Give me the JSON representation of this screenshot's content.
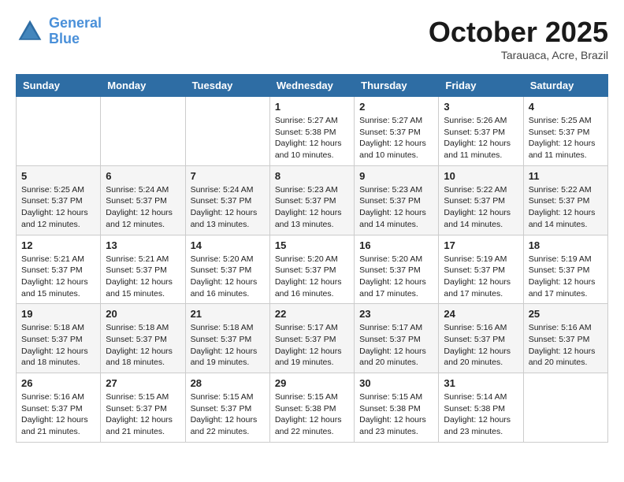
{
  "header": {
    "logo_line1": "General",
    "logo_line2": "Blue",
    "month": "October 2025",
    "location": "Tarauaca, Acre, Brazil"
  },
  "weekdays": [
    "Sunday",
    "Monday",
    "Tuesday",
    "Wednesday",
    "Thursday",
    "Friday",
    "Saturday"
  ],
  "weeks": [
    [
      {
        "day": "",
        "info": ""
      },
      {
        "day": "",
        "info": ""
      },
      {
        "day": "",
        "info": ""
      },
      {
        "day": "1",
        "info": "Sunrise: 5:27 AM\nSunset: 5:38 PM\nDaylight: 12 hours\nand 10 minutes."
      },
      {
        "day": "2",
        "info": "Sunrise: 5:27 AM\nSunset: 5:37 PM\nDaylight: 12 hours\nand 10 minutes."
      },
      {
        "day": "3",
        "info": "Sunrise: 5:26 AM\nSunset: 5:37 PM\nDaylight: 12 hours\nand 11 minutes."
      },
      {
        "day": "4",
        "info": "Sunrise: 5:25 AM\nSunset: 5:37 PM\nDaylight: 12 hours\nand 11 minutes."
      }
    ],
    [
      {
        "day": "5",
        "info": "Sunrise: 5:25 AM\nSunset: 5:37 PM\nDaylight: 12 hours\nand 12 minutes."
      },
      {
        "day": "6",
        "info": "Sunrise: 5:24 AM\nSunset: 5:37 PM\nDaylight: 12 hours\nand 12 minutes."
      },
      {
        "day": "7",
        "info": "Sunrise: 5:24 AM\nSunset: 5:37 PM\nDaylight: 12 hours\nand 13 minutes."
      },
      {
        "day": "8",
        "info": "Sunrise: 5:23 AM\nSunset: 5:37 PM\nDaylight: 12 hours\nand 13 minutes."
      },
      {
        "day": "9",
        "info": "Sunrise: 5:23 AM\nSunset: 5:37 PM\nDaylight: 12 hours\nand 14 minutes."
      },
      {
        "day": "10",
        "info": "Sunrise: 5:22 AM\nSunset: 5:37 PM\nDaylight: 12 hours\nand 14 minutes."
      },
      {
        "day": "11",
        "info": "Sunrise: 5:22 AM\nSunset: 5:37 PM\nDaylight: 12 hours\nand 14 minutes."
      }
    ],
    [
      {
        "day": "12",
        "info": "Sunrise: 5:21 AM\nSunset: 5:37 PM\nDaylight: 12 hours\nand 15 minutes."
      },
      {
        "day": "13",
        "info": "Sunrise: 5:21 AM\nSunset: 5:37 PM\nDaylight: 12 hours\nand 15 minutes."
      },
      {
        "day": "14",
        "info": "Sunrise: 5:20 AM\nSunset: 5:37 PM\nDaylight: 12 hours\nand 16 minutes."
      },
      {
        "day": "15",
        "info": "Sunrise: 5:20 AM\nSunset: 5:37 PM\nDaylight: 12 hours\nand 16 minutes."
      },
      {
        "day": "16",
        "info": "Sunrise: 5:20 AM\nSunset: 5:37 PM\nDaylight: 12 hours\nand 17 minutes."
      },
      {
        "day": "17",
        "info": "Sunrise: 5:19 AM\nSunset: 5:37 PM\nDaylight: 12 hours\nand 17 minutes."
      },
      {
        "day": "18",
        "info": "Sunrise: 5:19 AM\nSunset: 5:37 PM\nDaylight: 12 hours\nand 17 minutes."
      }
    ],
    [
      {
        "day": "19",
        "info": "Sunrise: 5:18 AM\nSunset: 5:37 PM\nDaylight: 12 hours\nand 18 minutes."
      },
      {
        "day": "20",
        "info": "Sunrise: 5:18 AM\nSunset: 5:37 PM\nDaylight: 12 hours\nand 18 minutes."
      },
      {
        "day": "21",
        "info": "Sunrise: 5:18 AM\nSunset: 5:37 PM\nDaylight: 12 hours\nand 19 minutes."
      },
      {
        "day": "22",
        "info": "Sunrise: 5:17 AM\nSunset: 5:37 PM\nDaylight: 12 hours\nand 19 minutes."
      },
      {
        "day": "23",
        "info": "Sunrise: 5:17 AM\nSunset: 5:37 PM\nDaylight: 12 hours\nand 20 minutes."
      },
      {
        "day": "24",
        "info": "Sunrise: 5:16 AM\nSunset: 5:37 PM\nDaylight: 12 hours\nand 20 minutes."
      },
      {
        "day": "25",
        "info": "Sunrise: 5:16 AM\nSunset: 5:37 PM\nDaylight: 12 hours\nand 20 minutes."
      }
    ],
    [
      {
        "day": "26",
        "info": "Sunrise: 5:16 AM\nSunset: 5:37 PM\nDaylight: 12 hours\nand 21 minutes."
      },
      {
        "day": "27",
        "info": "Sunrise: 5:15 AM\nSunset: 5:37 PM\nDaylight: 12 hours\nand 21 minutes."
      },
      {
        "day": "28",
        "info": "Sunrise: 5:15 AM\nSunset: 5:37 PM\nDaylight: 12 hours\nand 22 minutes."
      },
      {
        "day": "29",
        "info": "Sunrise: 5:15 AM\nSunset: 5:38 PM\nDaylight: 12 hours\nand 22 minutes."
      },
      {
        "day": "30",
        "info": "Sunrise: 5:15 AM\nSunset: 5:38 PM\nDaylight: 12 hours\nand 23 minutes."
      },
      {
        "day": "31",
        "info": "Sunrise: 5:14 AM\nSunset: 5:38 PM\nDaylight: 12 hours\nand 23 minutes."
      },
      {
        "day": "",
        "info": ""
      }
    ]
  ]
}
